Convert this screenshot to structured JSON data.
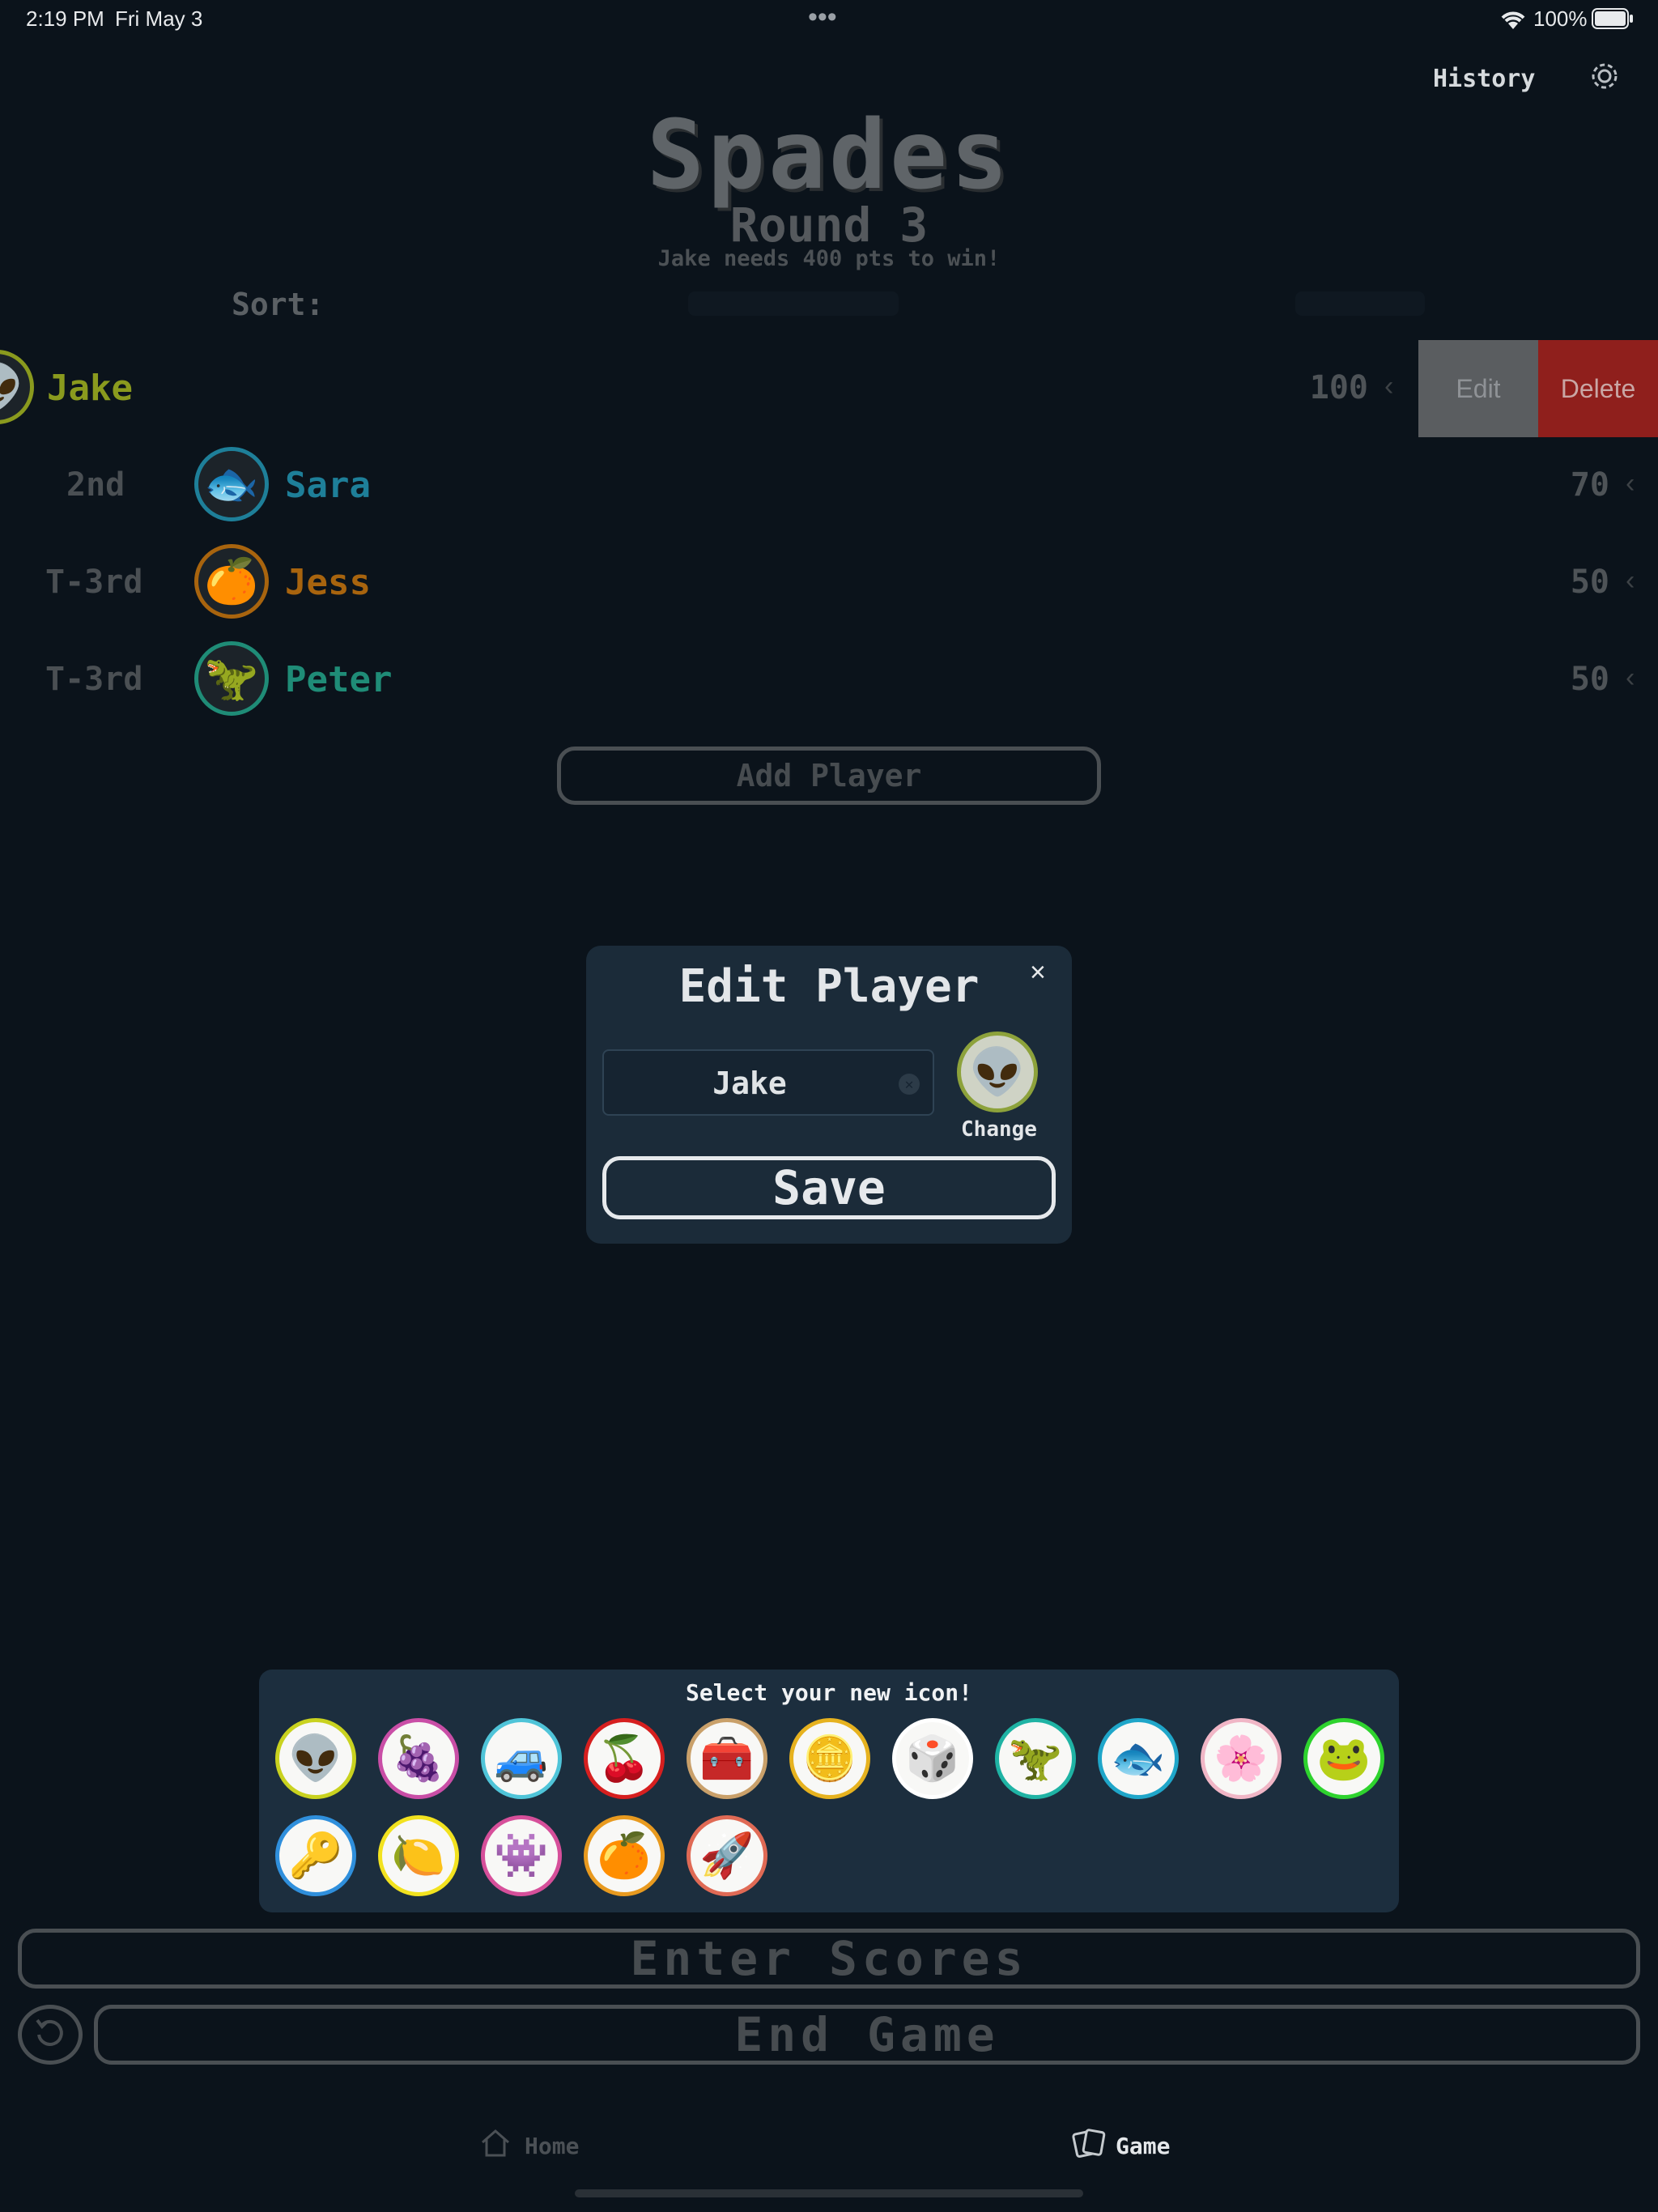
{
  "status_bar": {
    "time": "2:19 PM",
    "date": "Fri May 3",
    "dots": "•••",
    "battery": "100%"
  },
  "header": {
    "history": "History",
    "title": "Spades",
    "round": "Round 3",
    "subtitle": "Jake needs 400 pts to win!",
    "sort_label": "Sort:"
  },
  "players": [
    {
      "rank": "",
      "name": "Jake",
      "score": "100",
      "icon": "alien-icon",
      "color": "#8a9a1e"
    },
    {
      "rank": "2nd",
      "name": "Sara",
      "score": "70",
      "icon": "fish-icon",
      "color": "#1e7f99"
    },
    {
      "rank": "T-3rd",
      "name": "Jess",
      "score": "50",
      "icon": "orange-icon",
      "color": "#a8640e"
    },
    {
      "rank": "T-3rd",
      "name": "Peter",
      "score": "50",
      "icon": "dino-icon",
      "color": "#1f8c77"
    }
  ],
  "row_actions": {
    "edit": "Edit",
    "delete": "Delete"
  },
  "add_player": "Add Player",
  "modal": {
    "title": "Edit Player",
    "close": "×",
    "name_value": "Jake",
    "change": "Change",
    "save": "Save"
  },
  "picker": {
    "title": "Select your new icon!",
    "icons": [
      {
        "name": "alien-icon",
        "glyph": "👽",
        "border": "#c9d21f"
      },
      {
        "name": "grapes-icon",
        "glyph": "🍇",
        "border": "#c94ea6"
      },
      {
        "name": "car-icon",
        "glyph": "🚙",
        "border": "#4fc4d8"
      },
      {
        "name": "cherry-icon",
        "glyph": "🍒",
        "border": "#d61f1f"
      },
      {
        "name": "treasure-chest-icon",
        "glyph": "🧰",
        "border": "#c9a06a"
      },
      {
        "name": "coin-icon",
        "glyph": "🪙",
        "border": "#e6b21f"
      },
      {
        "name": "dice-icon",
        "glyph": "🎲",
        "border": "#ffffff"
      },
      {
        "name": "dino-icon",
        "glyph": "🦖",
        "border": "#1fb3a4"
      },
      {
        "name": "fish-icon",
        "glyph": "🐟",
        "border": "#1fa6c9"
      },
      {
        "name": "flower-icon",
        "glyph": "🌸",
        "border": "#f0b6c6"
      },
      {
        "name": "frog-icon",
        "glyph": "🐸",
        "border": "#2ed32e"
      },
      {
        "name": "key-icon",
        "glyph": "🔑",
        "border": "#2f8fdc"
      },
      {
        "name": "lemon-icon",
        "glyph": "🍋",
        "border": "#f2e21f"
      },
      {
        "name": "monster-icon",
        "glyph": "👾",
        "border": "#d64f9a"
      },
      {
        "name": "orange-icon",
        "glyph": "🍊",
        "border": "#e89a1f"
      },
      {
        "name": "rocket-icon",
        "glyph": "🚀",
        "border": "#e06a55"
      }
    ]
  },
  "buttons": {
    "enter_scores": "Enter Scores",
    "end_game": "End Game"
  },
  "tabs": [
    {
      "label": "Home"
    },
    {
      "label": "Game"
    }
  ]
}
